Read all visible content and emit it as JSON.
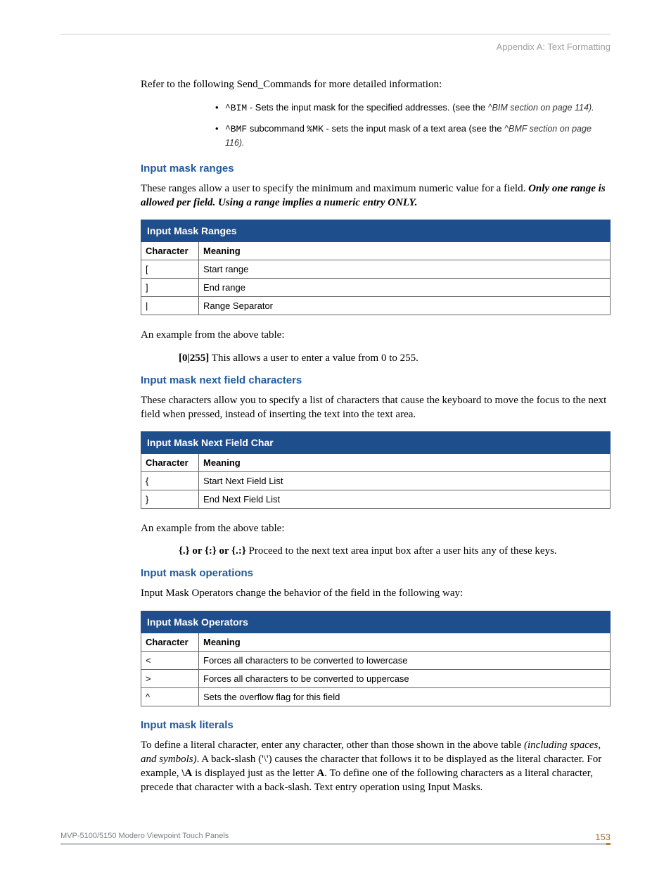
{
  "header": {
    "text": "Appendix A: Text Formatting"
  },
  "intro": "Refer to the following Send_Commands for more detailed information:",
  "bullets": [
    {
      "code": "^BIM",
      "rest": " - Sets the input mask for the specified addresses. (see the ",
      "ital": "^BIM",
      "after": " section on page 114)."
    },
    {
      "code": "^BMF",
      "mid": " subcommand ",
      "code2": "%MK",
      "rest2": " - sets the input mask of a text area (see the ",
      "ital": "^BMF",
      "after": " section on page 116)."
    }
  ],
  "sec1": {
    "title": "Input mask ranges",
    "p_lead": "These ranges allow a user to specify the minimum and maximum numeric value for a field. ",
    "p_bold": "Only one range is allowed per field. Using a range implies a numeric entry ONLY.",
    "table_title": "Input Mask Ranges",
    "col1": "Character",
    "col2": "Meaning",
    "rows": [
      {
        "c": "[",
        "m": "Start range"
      },
      {
        "c": "]",
        "m": "End range"
      },
      {
        "c": "|",
        "m": "Range Separator"
      }
    ],
    "ex_intro": "An example from the above table:",
    "ex_bold": "[0|255]",
    "ex_rest": " This allows a user to enter a value from 0 to 255."
  },
  "sec2": {
    "title": "Input mask next field characters",
    "p": "These characters allow you to specify a list of characters that cause the keyboard to move the focus to the next field when pressed, instead of inserting the text into the text area.",
    "table_title": "Input Mask Next Field Char",
    "col1": "Character",
    "col2": "Meaning",
    "rows": [
      {
        "c": "{",
        "m": "Start Next Field List"
      },
      {
        "c": "}",
        "m": "End Next Field List"
      }
    ],
    "ex_intro": "An example from the above table:",
    "ex_bold": "{.} or {:} or {.:}",
    "ex_rest": " Proceed to the next text area input box after a user hits any of these keys."
  },
  "sec3": {
    "title": "Input mask operations",
    "p": "Input Mask Operators change the behavior of the field in the following way:",
    "table_title": "Input Mask Operators",
    "col1": "Character",
    "col2": "Meaning",
    "rows": [
      {
        "c": "<",
        "m": "Forces all characters to be converted to lowercase"
      },
      {
        "c": ">",
        "m": "Forces all characters to be converted to uppercase"
      },
      {
        "c": "^",
        "m": "Sets the overflow flag for this field"
      }
    ]
  },
  "sec4": {
    "title": "Input mask literals",
    "p1a": "To define a literal character, enter any character, other than those shown in the above table ",
    "p1ital": "(including spaces, and symbols)",
    "p1b": ". A back-slash ('\\') causes the character that follows it to be displayed as the literal character. For example, ",
    "p1bold": "\\A",
    "p1c": " is displayed just as the letter ",
    "p1bold2": "A",
    "p1d": ". To define one of the following characters as a literal character, precede that character with a back-slash. Text entry operation using Input Masks."
  },
  "footer": {
    "text": "MVP-5100/5150 Modero Viewpoint  Touch Panels",
    "page": "153"
  }
}
